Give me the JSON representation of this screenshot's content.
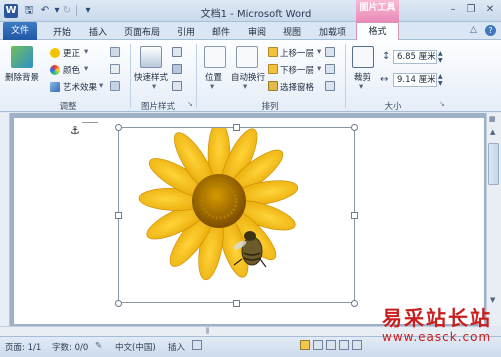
{
  "app": {
    "title": "文档1 - Microsoft Word",
    "app_icon_letter": "W",
    "contextual_group": "图片工具"
  },
  "qat": {
    "save_icon": "save-icon",
    "undo_icon": "undo-icon",
    "redo_icon": "redo-icon",
    "customize_icon": "customize-qat-icon"
  },
  "window_controls": {
    "minimize": "–",
    "restore": "❐",
    "close": "✕",
    "help": "?",
    "ribbon_min": "△"
  },
  "tabs": {
    "file": "文件",
    "home": "开始",
    "insert": "插入",
    "layout": "页面布局",
    "references": "引用",
    "mailings": "邮件",
    "review": "审阅",
    "view": "视图",
    "addins": "加载项",
    "format": "格式"
  },
  "ribbon": {
    "adjust": {
      "label": "调整",
      "remove_bg": "删除背景",
      "corrections": "更正",
      "color": "颜色",
      "artistic": "艺术效果"
    },
    "styles": {
      "label": "图片样式",
      "quick_styles": "快速样式"
    },
    "arrange": {
      "label": "排列",
      "position": "位置",
      "wrap": "自动换行",
      "bring_forward": "上移一层",
      "send_backward": "下移一层",
      "selection_pane": "选择窗格"
    },
    "size": {
      "label": "大小",
      "crop": "裁剪",
      "height": "6.85 厘米",
      "width": "9.14 厘米"
    }
  },
  "status": {
    "page": "页面: 1/1",
    "words": "字数: 0/0",
    "language": "中文(中国)",
    "insert_mode": "插入"
  },
  "watermark": {
    "text": "易采站长站",
    "url": "www.easck.com"
  }
}
